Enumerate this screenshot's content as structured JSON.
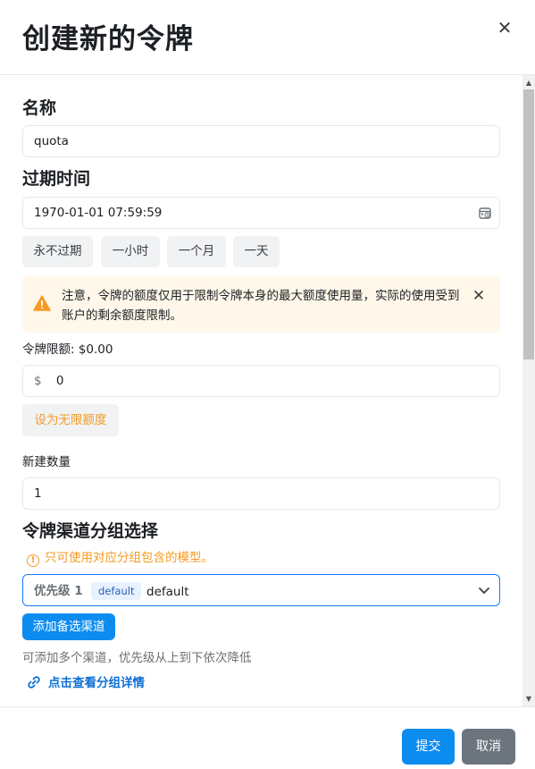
{
  "header": {
    "title": "创建新的令牌"
  },
  "name": {
    "label": "名称",
    "value": "quota"
  },
  "expiry": {
    "label": "过期时间",
    "value": "1970-01-01 07:59:59",
    "quick": [
      "永不过期",
      "一小时",
      "一个月",
      "一天"
    ]
  },
  "notice": {
    "text": "注意，令牌的额度仅用于限制令牌本身的最大额度使用量，实际的使用受到账户的剩余额度限制。"
  },
  "quota": {
    "label": "令牌限额: $0.00",
    "prefix": "$",
    "value": "0",
    "unlimited_label": "设为无限额度"
  },
  "count": {
    "label": "新建数量",
    "value": "1"
  },
  "group": {
    "title": "令牌渠道分组选择",
    "tip": "只可使用对应分组包含的模型。",
    "priority": "优先级 1",
    "tag": "default",
    "value": "default",
    "add_label": "添加备选渠道",
    "hint": "可添加多个渠道，优先级从上到下依次降低",
    "link": "点击查看分组详情"
  },
  "footer": {
    "submit": "提交",
    "cancel": "取消"
  },
  "colors": {
    "primary": "#0d8cf0",
    "warning": "#f59a23",
    "warning_bg": "#fff8ea",
    "cancel_bg": "#6c757d"
  },
  "icons": [
    "close-icon",
    "calendar-icon",
    "warning-icon",
    "info-icon",
    "chevron-down-icon",
    "link-icon"
  ]
}
